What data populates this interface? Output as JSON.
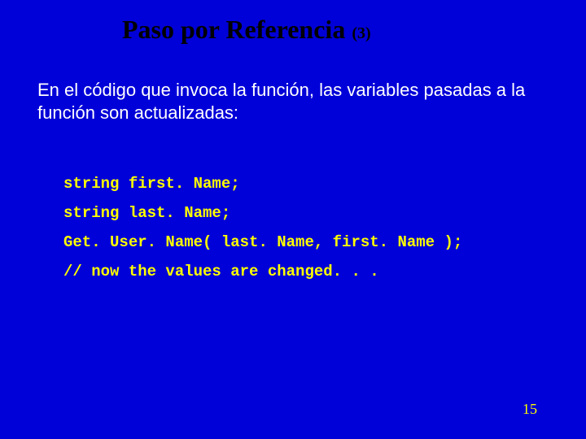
{
  "title": {
    "main": "Paso por Referencia ",
    "sub": "(3)"
  },
  "body": "En el código que invoca la función, las variables pasadas a la función son actualizadas:",
  "code": {
    "l1": "string first. Name;",
    "l2": "string last. Name;",
    "l3": "Get. User. Name( last. Name, first. Name );",
    "l4": "// now the values are changed. . ."
  },
  "page_number": "15"
}
